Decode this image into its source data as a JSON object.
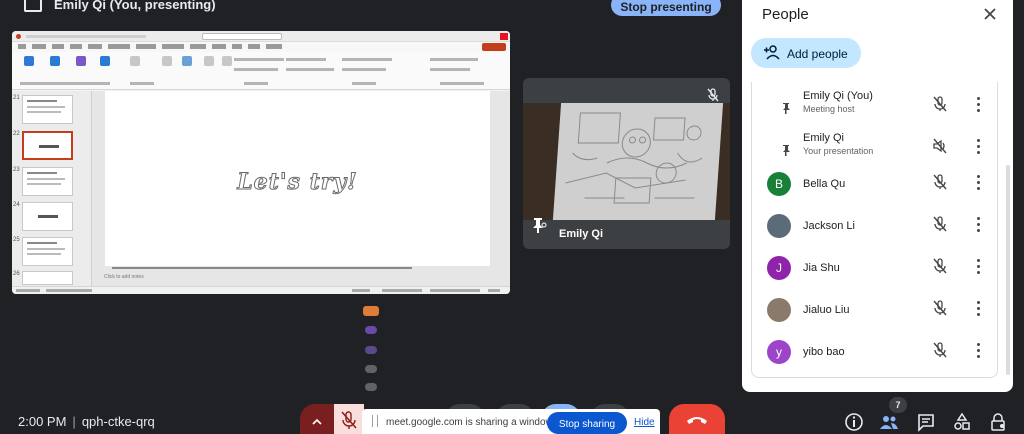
{
  "presenting": {
    "label": "Emily Qi (You, presenting)",
    "stop_label": "Stop presenting"
  },
  "shared_window": {
    "slide_text": "Let's try!",
    "notes_placeholder": "Click to add notes",
    "thumb_numbers": [
      "21",
      "22",
      "23",
      "24",
      "25",
      "26"
    ]
  },
  "camera_tile": {
    "name": "Emily Qi"
  },
  "people_panel": {
    "title": "People",
    "add_people_label": "Add people",
    "participants": [
      {
        "name": "Emily Qi (You)",
        "subtitle": "Meeting host",
        "avatar": "",
        "avatar_color": "",
        "icon": "pin-icon"
      },
      {
        "name": "Emily Qi",
        "subtitle": "Your presentation",
        "avatar": "",
        "avatar_color": "",
        "icon": "pin-icon"
      },
      {
        "name": "Bella Qu",
        "subtitle": "",
        "avatar": "B",
        "avatar_color": "#188038"
      },
      {
        "name": "Jackson Li",
        "subtitle": "",
        "avatar": "",
        "avatar_color": "#5b6b7a"
      },
      {
        "name": "Jia Shu",
        "subtitle": "",
        "avatar": "J",
        "avatar_color": "#8e24aa"
      },
      {
        "name": "Jialuo Liu",
        "subtitle": "",
        "avatar": "",
        "avatar_color": "#8a7a6a"
      },
      {
        "name": "yibo bao",
        "subtitle": "",
        "avatar": "y",
        "avatar_color": "#9c45c8"
      }
    ]
  },
  "bottom_bar": {
    "time": "2:00 PM",
    "meeting_code": "qph-ctke-qrq",
    "share_message": "meet.google.com is sharing a window.",
    "stop_sharing_label": "Stop sharing",
    "hide_label": "Hide",
    "participant_count": "7"
  },
  "colors": {
    "background": "#202124",
    "accent": "#8ab4f8",
    "end_call": "#ea4335",
    "share_blue": "#0b57d0"
  }
}
